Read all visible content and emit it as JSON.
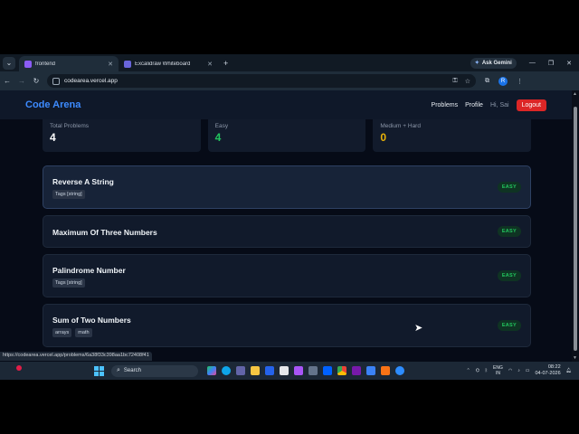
{
  "browser": {
    "tabs": [
      {
        "title": "frontend",
        "active": true,
        "favicon_color": "#8b5cf6"
      },
      {
        "title": "Excalidraw Whiteboard",
        "active": false,
        "favicon_color": "#6965db"
      }
    ],
    "ask_gemini": "Ask Gemini",
    "url": "codearea.vercel.app",
    "profile_initial": "R",
    "status_url": "https://codearea.vercel.app/problems/6a38f33c398aa1bc72408f41"
  },
  "app": {
    "brand": "Code Arena",
    "nav": {
      "problems": "Problems",
      "profile": "Profile",
      "greeting": "Hi, Sai",
      "logout": "Logout"
    },
    "stats": [
      {
        "label": "Total Problems",
        "value": "4",
        "color": "#ffffff"
      },
      {
        "label": "Easy",
        "value": "4",
        "color": "#22c55e"
      },
      {
        "label": "Medium + Hard",
        "value": "0",
        "color": "#eab308"
      }
    ],
    "problems": [
      {
        "name": "Reverse A String",
        "tags": [
          "Tags [string]"
        ],
        "difficulty": "EASY",
        "highlighted": true
      },
      {
        "name": "Maximum Of Three Numbers",
        "tags": [],
        "difficulty": "EASY",
        "highlighted": false
      },
      {
        "name": "Palindrome Number",
        "tags": [
          "Tags [string]"
        ],
        "difficulty": "EASY",
        "highlighted": false
      },
      {
        "name": "Sum of Two Numbers",
        "tags": [
          "arrays",
          "math"
        ],
        "difficulty": "EASY",
        "highlighted": false
      }
    ]
  },
  "taskbar": {
    "search_placeholder": "Search",
    "lang_line1": "ENG",
    "lang_line2": "IN",
    "time": "08:22",
    "date": "04-07-2026",
    "notification_count": "1"
  }
}
